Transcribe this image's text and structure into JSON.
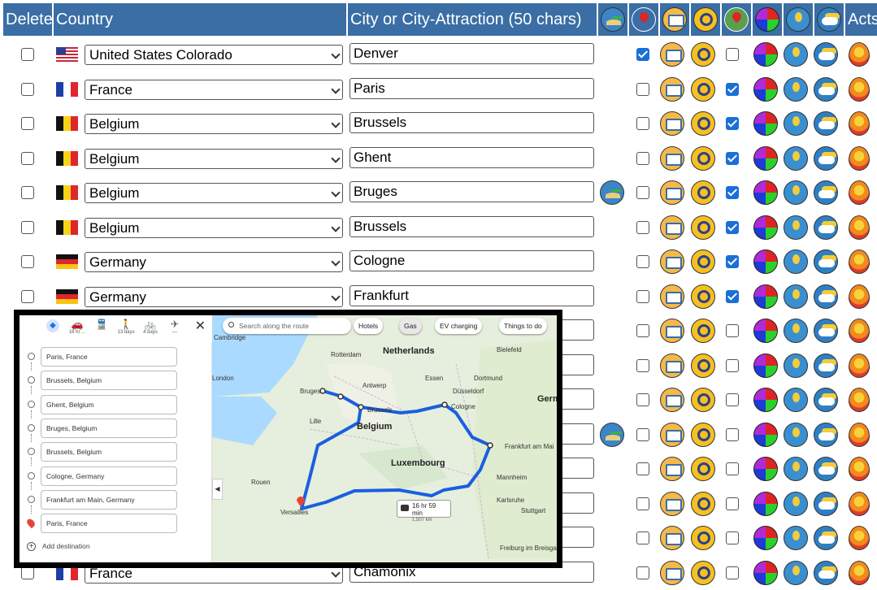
{
  "header": {
    "delete": "Delete",
    "country": "Country",
    "city": "City or City-Attraction (50 chars)",
    "acts": "Acts",
    "icons": [
      "island-icon",
      "location-pin-icon",
      "info-card-icon",
      "magnifier-icon",
      "map-pins-icon",
      "pie-chart-icon",
      "hand-coin-icon",
      "weather-icon"
    ]
  },
  "colors": {
    "header_bg": "#3a6ea5",
    "checkbox_on": "#1a6fd8",
    "route": "#1a5fe0"
  },
  "rows": [
    {
      "country": "United States Colorado",
      "flag": "us",
      "city": "Denver",
      "island": false,
      "pin_checked": true,
      "map_checked": false
    },
    {
      "country": "France",
      "flag": "fr",
      "city": "Paris",
      "island": false,
      "pin_checked": false,
      "map_checked": true
    },
    {
      "country": "Belgium",
      "flag": "be",
      "city": "Brussels",
      "island": false,
      "pin_checked": false,
      "map_checked": true
    },
    {
      "country": "Belgium",
      "flag": "be",
      "city": "Ghent",
      "island": false,
      "pin_checked": false,
      "map_checked": true
    },
    {
      "country": "Belgium",
      "flag": "be",
      "city": "Bruges",
      "island": true,
      "pin_checked": false,
      "map_checked": true
    },
    {
      "country": "Belgium",
      "flag": "be",
      "city": "Brussels",
      "island": false,
      "pin_checked": false,
      "map_checked": true
    },
    {
      "country": "Germany",
      "flag": "de",
      "city": "Cologne",
      "island": false,
      "pin_checked": false,
      "map_checked": true
    },
    {
      "country": "Germany",
      "flag": "de",
      "city": "Frankfurt",
      "island": false,
      "pin_checked": false,
      "map_checked": true
    },
    {
      "country": "",
      "flag": "",
      "city": "",
      "island": false,
      "pin_checked": false,
      "map_checked": false
    },
    {
      "country": "",
      "flag": "",
      "city": "",
      "island": false,
      "pin_checked": false,
      "map_checked": false
    },
    {
      "country": "",
      "flag": "",
      "city": "",
      "island": false,
      "pin_checked": false,
      "map_checked": false
    },
    {
      "country": "",
      "flag": "",
      "city": "",
      "island": true,
      "pin_checked": false,
      "map_checked": false
    },
    {
      "country": "",
      "flag": "",
      "city": "",
      "island": false,
      "pin_checked": false,
      "map_checked": false
    },
    {
      "country": "",
      "flag": "",
      "city": "",
      "island": false,
      "pin_checked": false,
      "map_checked": false
    },
    {
      "country": "",
      "flag": "",
      "city": "",
      "island": false,
      "pin_checked": false,
      "map_checked": false
    },
    {
      "country": "France",
      "flag": "fr",
      "city": "Chamonix",
      "island": false,
      "pin_checked": false,
      "map_checked": false
    }
  ],
  "map_overlay": {
    "modes": [
      {
        "icon": "directions-icon",
        "label": ""
      },
      {
        "icon": "car-icon",
        "label": "16 hr ..."
      },
      {
        "icon": "train-icon",
        "label": ""
      },
      {
        "icon": "walk-icon",
        "label": "13 days"
      },
      {
        "icon": "bike-icon",
        "label": "4 days"
      },
      {
        "icon": "plane-icon",
        "label": "—"
      }
    ],
    "stops": [
      "Paris, France",
      "Brussels, Belgium",
      "Ghent, Belgium",
      "Bruges, Belgium",
      "Brussels, Belgium",
      "Cologne, Germany",
      "Frankfurt am Main, Germany",
      "Paris, France"
    ],
    "add_destination": "Add destination",
    "search_placeholder": "Search along the route",
    "chips": [
      "Hotels",
      "Gas",
      "EV charging",
      "Things to do"
    ],
    "labels": [
      "Cambridge",
      "Netherlands",
      "Rotterdam",
      "Bielefeld",
      "London",
      "Antwerp",
      "Essen",
      "Dortmund",
      "Bruges",
      "Düsseldorf",
      "Brussels",
      "Cologne",
      "Germ",
      "Lille",
      "Belgium",
      "Frankfurt am Mai",
      "Luxembourg",
      "Mannheim",
      "Rouen",
      "Karlsruhe",
      "Versailles",
      "Stuttgart",
      "Freiburg im Breisgau"
    ],
    "route_time": "16 hr 59 min",
    "route_distance": "1,507 km"
  }
}
